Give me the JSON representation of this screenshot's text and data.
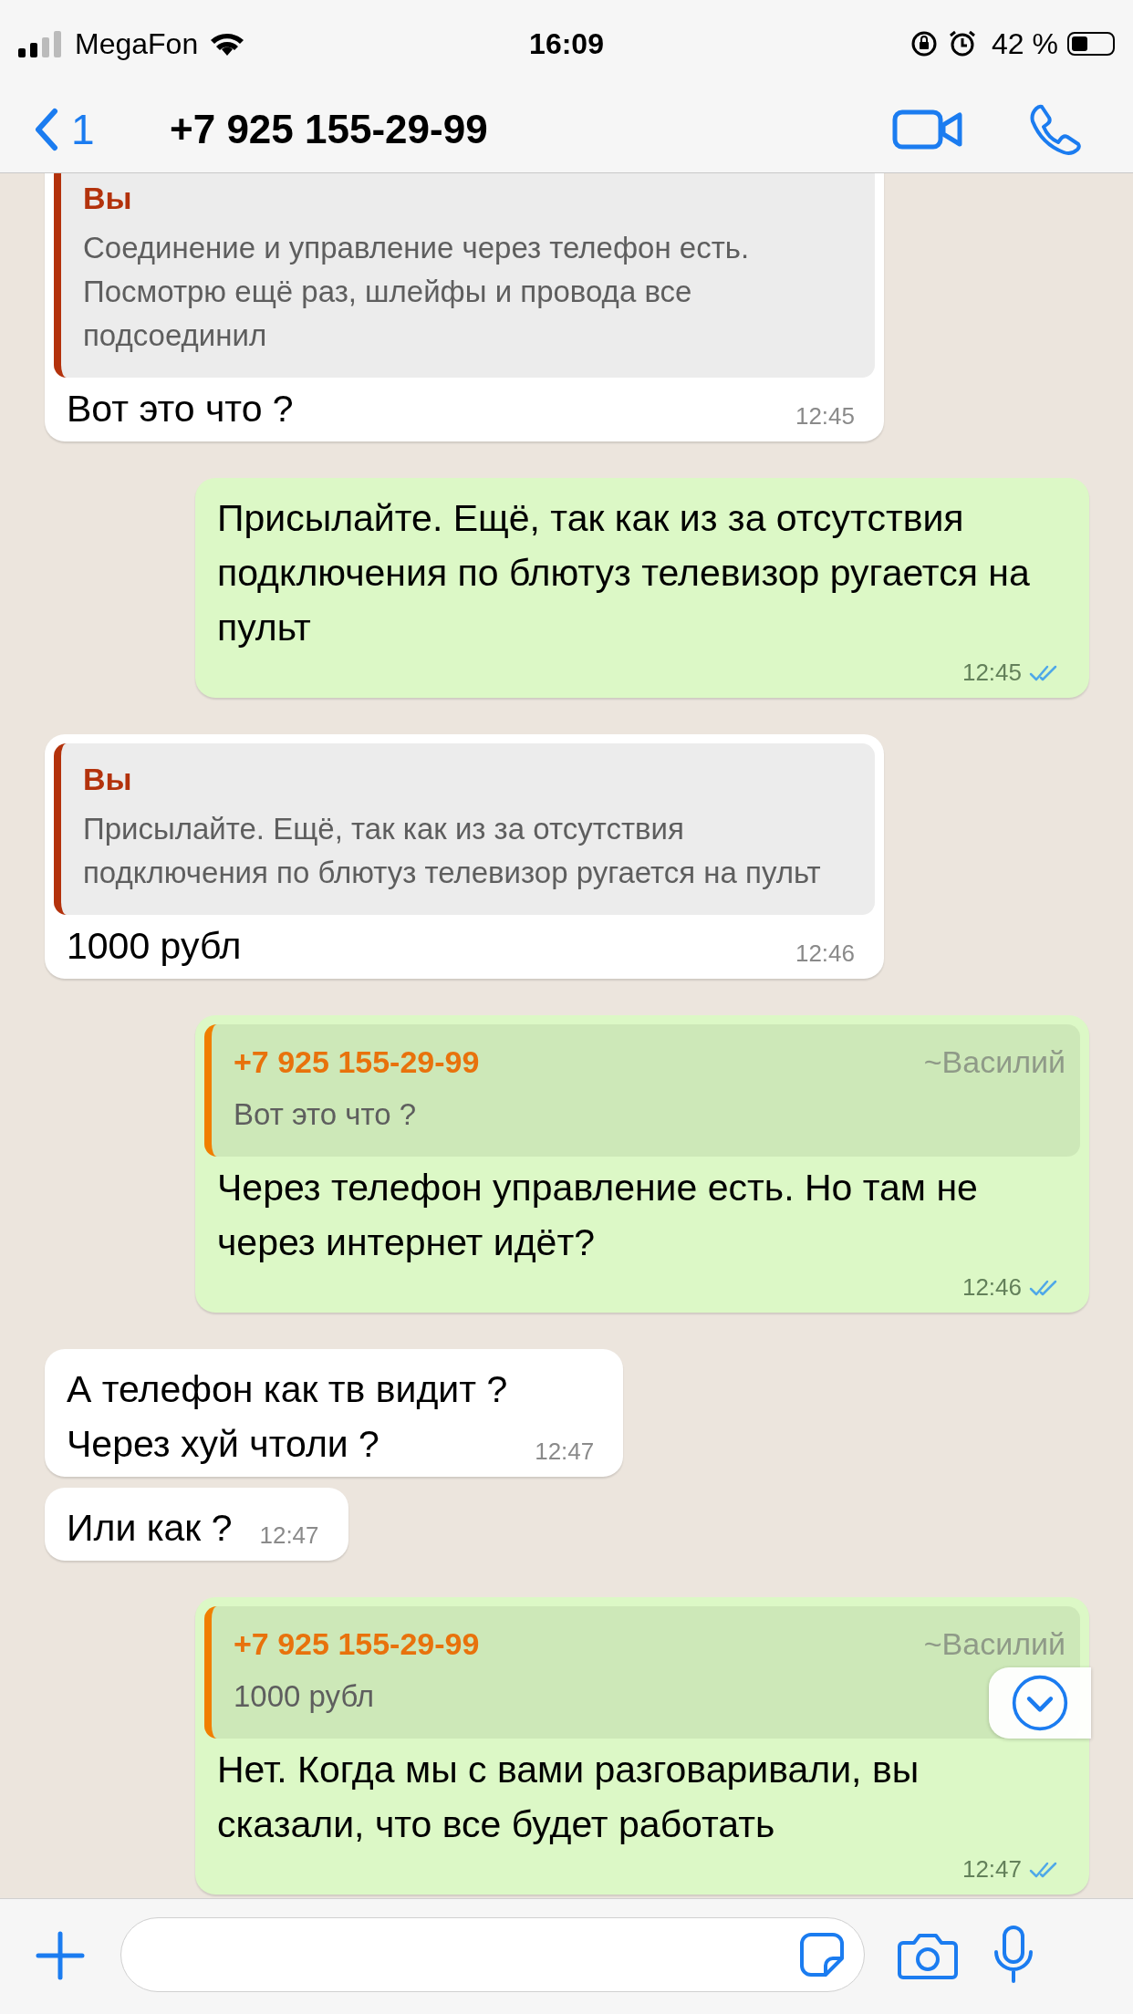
{
  "status_bar": {
    "carrier": "MegaFon",
    "time": "16:09",
    "battery": "42 %"
  },
  "header": {
    "back_count": "1",
    "title": "+7 925 155-29-99"
  },
  "messages": [
    {
      "kind": "in",
      "quote": {
        "author": "Вы",
        "text": "Соединение и управление через телефон есть. Посмотрю ещё раз, шлейфы и провода все подсоединил"
      },
      "text": "Вот это что ?",
      "time": "12:45"
    },
    {
      "kind": "out",
      "text": "Присылайте. Ещё, так как из за отсутствия подключения по блютуз телевизор ругается на пульт",
      "time": "12:45",
      "read": true
    },
    {
      "kind": "in",
      "quote": {
        "author": "Вы",
        "text": "Присылайте. Ещё, так как из за отсутствия подключения по блютуз телевизор ругается на пульт"
      },
      "text": "1000 рубл",
      "time": "12:46"
    },
    {
      "kind": "out",
      "quote": {
        "author": "+7 925 155-29-99",
        "push_name": "~Василий",
        "text": "Вот это что ?"
      },
      "text": "Через телефон управление есть. Но там не через интернет идёт?",
      "time": "12:46",
      "read": true
    },
    {
      "kind": "in",
      "text": "А телефон как тв видит ?\nЧерез хуй чтоли ?",
      "time": "12:47"
    },
    {
      "kind": "in",
      "text": "Или как ?",
      "time": "12:47"
    },
    {
      "kind": "out",
      "quote": {
        "author": "+7 925 155-29-99",
        "push_name": "~Василий",
        "text": "1000 рубл"
      },
      "text": "Нет. Когда мы с вами разговаривали, вы сказали, что все будет работать",
      "time": "12:47",
      "read": true
    }
  ]
}
